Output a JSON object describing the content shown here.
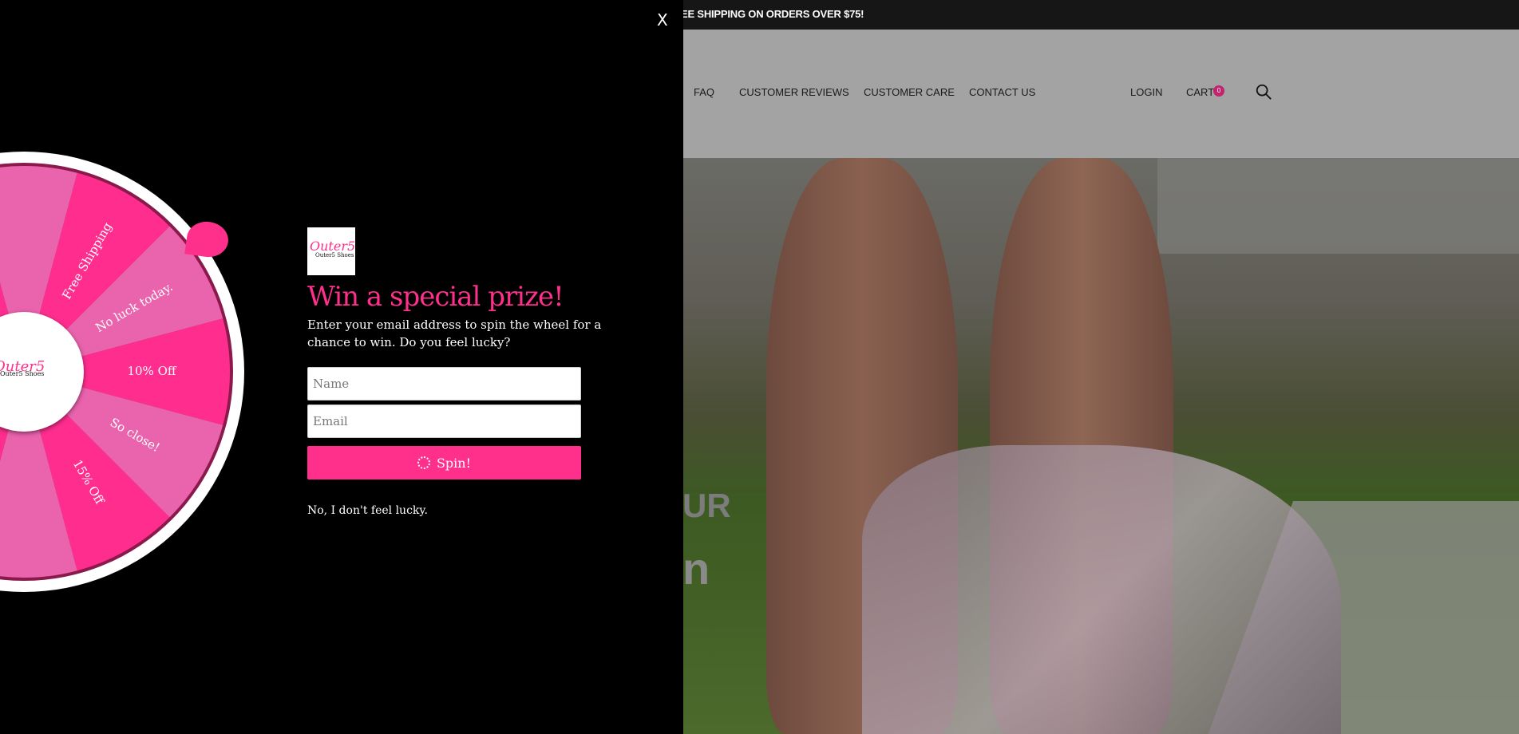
{
  "announcement": "EE SHIPPING ON ORDERS OVER $75!",
  "nav": {
    "items": [
      "FAQ",
      "CUSTOMER REVIEWS",
      "CUSTOMER CARE",
      "CONTACT US"
    ],
    "login": "LOGIN",
    "cart": "CART",
    "cart_count": "0"
  },
  "hero": {
    "line1": "UR",
    "line2": "n"
  },
  "popup": {
    "close": "X",
    "title": "Win a special prize!",
    "description": "Enter your email address to spin the wheel for a chance to win. Do you feel lucky?",
    "name_placeholder": "Name",
    "email_placeholder": "Email",
    "spin_label": "Spin!",
    "decline_label": "No, I don't feel lucky."
  },
  "wheel": {
    "segments": [
      "Free Shipping",
      "No luck today.",
      "10% Off",
      "So close!",
      "15% Off"
    ],
    "colors": {
      "dark": "#ff2d8e",
      "light": "#ea63ad",
      "rim": "#ffffff"
    }
  },
  "colors": {
    "accent": "#ff2f8c"
  }
}
